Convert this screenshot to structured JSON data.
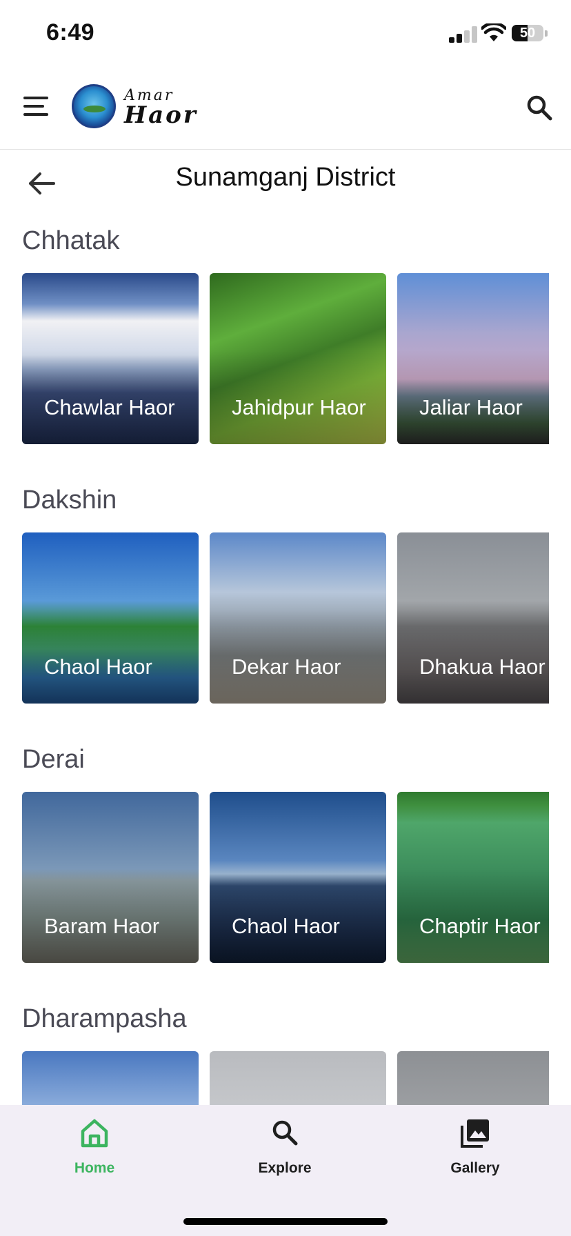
{
  "status_bar": {
    "time": "6:49",
    "battery": "50"
  },
  "app_bar": {
    "brand_line1": "Amar",
    "brand_line2": "Haor"
  },
  "page": {
    "title": "Sunamganj District"
  },
  "sections": [
    {
      "title": "Chhatak",
      "cards": [
        {
          "label": "Chawlar Haor",
          "bg": "linear-gradient(to bottom,#2a4a8a 0%,#6f8fc4 18%,#f1f1f4 28%,#cfd8e8 48%,#8ea2c4 56%,#3a4c7a 70%,#1e2c50 100%)"
        },
        {
          "label": "Jahidpur Haor",
          "bg": "linear-gradient(160deg,#2f6a1e 0%,#5fae3c 30%,#3f7d28 50%,#7fb83a 70%,#b7c34a 100%)"
        },
        {
          "label": "Jaliar Haor",
          "bg": "linear-gradient(to bottom,#5f8fd6 0%,#a9a6cf 35%,#c9a8c6 62%,#6a7f8f 72%,#3c5a3c 88%,#2d2d2d 100%)"
        }
      ]
    },
    {
      "title": "Dakshin",
      "cards": [
        {
          "label": "Chaol Haor",
          "bg": "linear-gradient(to bottom,#1f5fbf 0%,#5a9ad8 40%,#2f8a3a 55%,#3f9a6a 68%,#2d6fa8 85%,#1e4e88 100%)"
        },
        {
          "label": "Dekar Haor",
          "bg": "linear-gradient(to bottom,#5c88c9 0%,#b6c6da 35%,#8f9aa4 55%,#7b7f80 72%,#a29a8c 100%)"
        },
        {
          "label": "Dhakua Haor",
          "bg": "linear-gradient(to bottom,#8a8f96 0%,#a2a6aa 40%,#6f7072 55%,#6a6566 80%,#4e4a4c 100%)"
        }
      ]
    },
    {
      "title": "Derai",
      "cards": [
        {
          "label": "Baram Haor",
          "bg": "linear-gradient(to bottom,#41689c 0%,#7b98b8 45%,#8a9aa0 52%,#7c8a86 75%,#6f6e64 100%)"
        },
        {
          "label": "Chaol Haor",
          "bg": "linear-gradient(to bottom,#1f4e8c 0%,#5a86bf 40%,#9ab4cf 48%,#2f4a70 55%,#1d3050 80%,#0f1d33 100%)"
        },
        {
          "label": "Chaptir Haor",
          "bg": "linear-gradient(to bottom,#2f7a2f 0%,#3f8f3f 8%,#4fa66a 18%,#3a8a5a 50%,#2e7a4a 75%,#5a9a5a 100%)"
        }
      ]
    },
    {
      "title": "Dharampasha",
      "cards": [
        {
          "label": "",
          "bg": "linear-gradient(to bottom,#4a78c0 0%,#9bb9e2 40%,#7aa0d4 100%)"
        },
        {
          "label": "",
          "bg": "linear-gradient(to bottom,#b9bbbf 0%,#cfd1d4 60%,#c4c6c9 100%)"
        },
        {
          "label": "",
          "bg": "linear-gradient(to bottom,#8d9094 0%,#a9abae 60%,#6f8a6a 100%)"
        }
      ]
    }
  ],
  "bottom_nav": [
    {
      "label": "Home",
      "active": true
    },
    {
      "label": "Explore",
      "active": false
    },
    {
      "label": "Gallery",
      "active": false
    }
  ]
}
